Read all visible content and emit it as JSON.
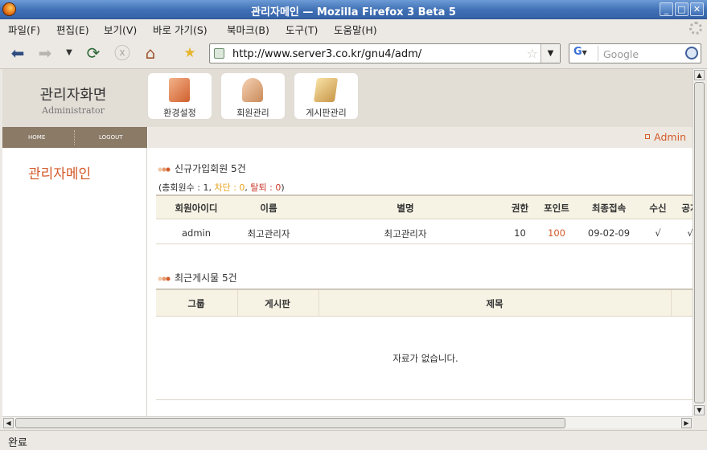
{
  "window": {
    "title": "관리자메인 — Mozilla Firefox 3 Beta 5",
    "controls": [
      "_",
      "□",
      "✕"
    ]
  },
  "menubar": [
    {
      "label": "파일(F)"
    },
    {
      "label": "편집(E)"
    },
    {
      "label": "보기(V)"
    },
    {
      "label": "바로 가기(S)"
    },
    {
      "label": "북마크(B)"
    },
    {
      "label": "도구(T)"
    },
    {
      "label": "도움말(H)"
    }
  ],
  "navbar": {
    "url": "http://www.server3.co.kr/gnu4/adm/",
    "search_placeholder": "Google",
    "search_engine": "G"
  },
  "page": {
    "brand_title": "관리자화면",
    "brand_subtitle": "Administrator",
    "top_icons": [
      {
        "label": "환경설정",
        "icon": "monitor-icon"
      },
      {
        "label": "회원관리",
        "icon": "members-icon"
      },
      {
        "label": "게시판관리",
        "icon": "board-icon"
      }
    ],
    "leftnav": {
      "home": "HOME",
      "logout": "LOGOUT",
      "page_title": "관리자메인"
    },
    "admin_link": "Admin",
    "members_section": {
      "title": "신규가입회원 5건",
      "summary_prefix": "(총회원수 : 1, ",
      "blocked": "차단 : 0",
      "comma": ", ",
      "withdrawn": "탈퇴 : 0",
      "summary_suffix": ")",
      "columns": [
        "회원아이디",
        "이름",
        "별명",
        "권한",
        "포인트",
        "최종접속",
        "수신",
        "공개"
      ],
      "rows": [
        {
          "id": "admin",
          "name": "최고관리자",
          "nick": "최고관리자",
          "level": "10",
          "point": "100",
          "last": "09-02-09",
          "recv": "√",
          "open": "√"
        }
      ]
    },
    "posts_section": {
      "title": "최근게시물 5건",
      "columns": [
        "그룹",
        "게시판",
        "제목"
      ],
      "empty_message": "자료가 없습니다."
    }
  },
  "status": {
    "text": "완료"
  },
  "colors": {
    "accent": "#d35a2a",
    "nav_bar": "#8a7a66",
    "header_bg": "#e2ddd5",
    "table_head": "#f6f2e4"
  }
}
